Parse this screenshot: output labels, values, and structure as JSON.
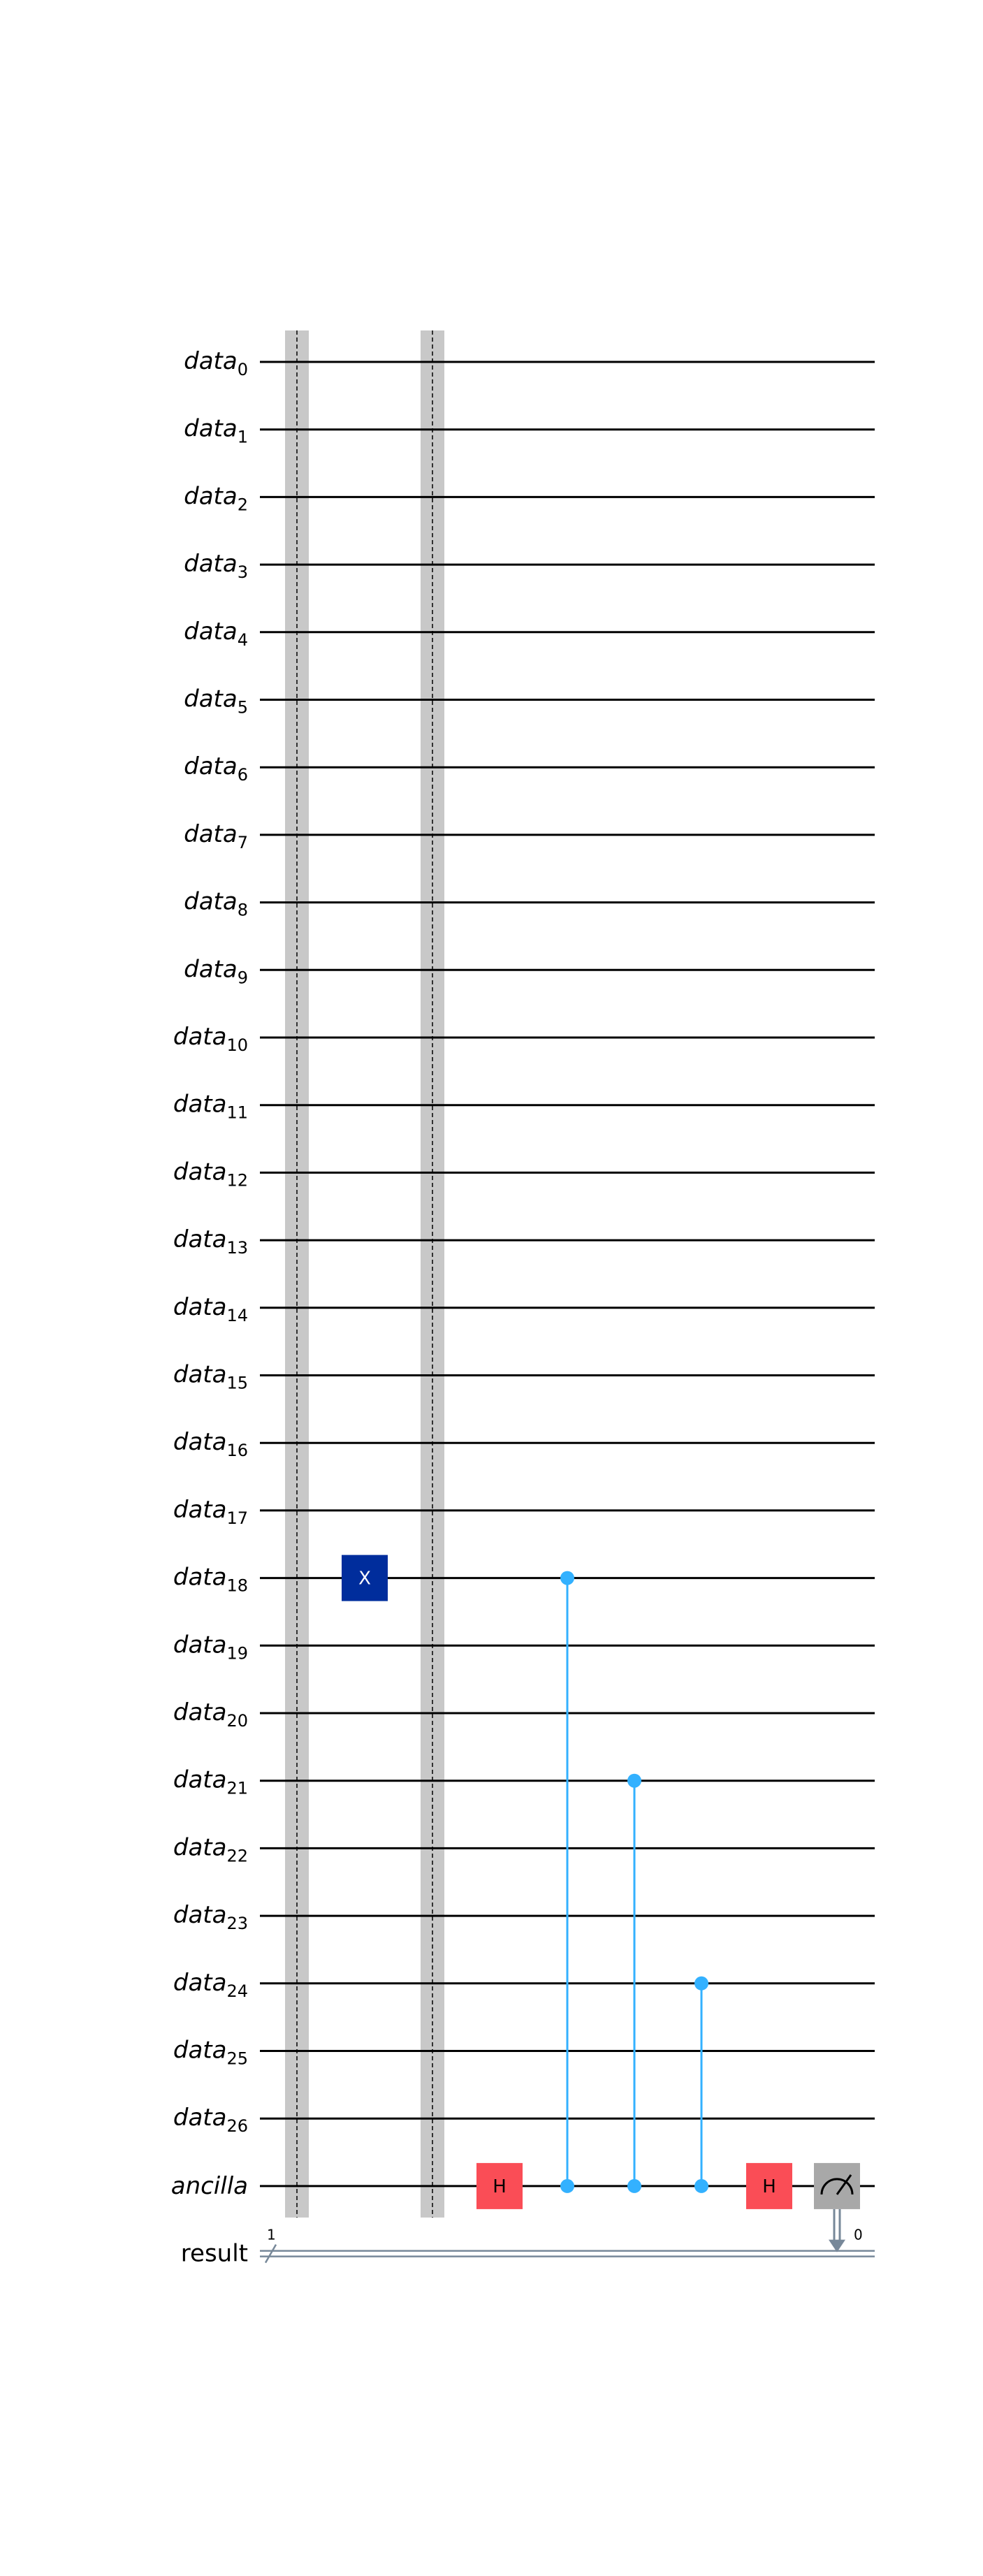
{
  "circuit": {
    "qubit_prefix": "data",
    "qubit_indices": [
      "0",
      "1",
      "2",
      "3",
      "4",
      "5",
      "6",
      "7",
      "8",
      "9",
      "10",
      "11",
      "12",
      "13",
      "14",
      "15",
      "16",
      "17",
      "18",
      "19",
      "20",
      "21",
      "22",
      "23",
      "24",
      "25",
      "26"
    ],
    "ancilla_label": "ancilla",
    "classical_label": "result",
    "classical_bus_width": "1",
    "measure_bit_index": "0",
    "x_gate_label": "X",
    "h_gate_label": "H",
    "x_gate_target_index": 18,
    "control_indices": [
      18,
      21,
      24
    ],
    "colors": {
      "wire": "#000000",
      "barrier": "#c8c8c8",
      "x_gate": "#002d9c",
      "h_gate": "#fa4d56",
      "control": "#33b1ff",
      "measure": "#a8a8a8",
      "classical": "#778899"
    }
  }
}
